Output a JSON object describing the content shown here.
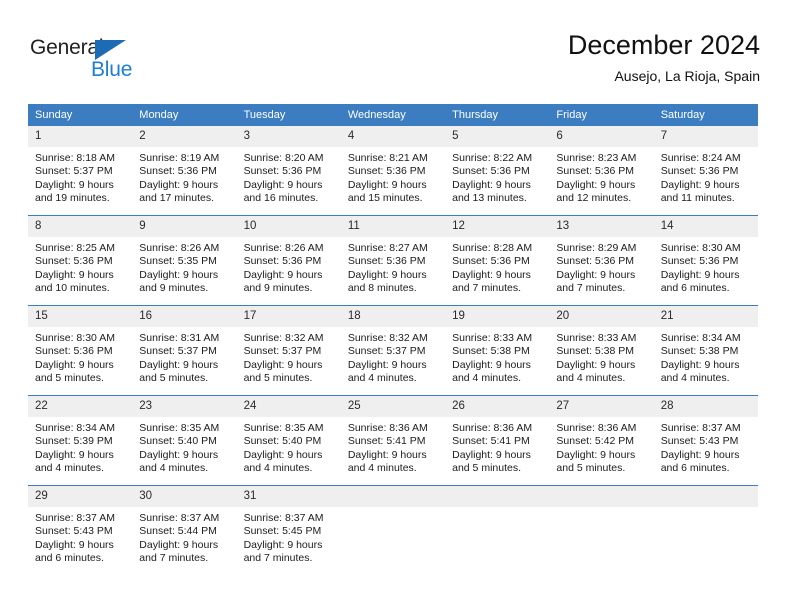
{
  "brand": {
    "name_part1": "General",
    "name_part2": "Blue",
    "triangle_color": "#1b6cb5",
    "blue_color": "#1b7fd4"
  },
  "header": {
    "title": "December 2024",
    "subtitle": "Ausejo, La Rioja, Spain"
  },
  "theme": {
    "header_bg": "#3b7dc0",
    "daynum_bg": "#efefef",
    "separator": "#3b7dc0"
  },
  "weekday_headers": [
    "Sunday",
    "Monday",
    "Tuesday",
    "Wednesday",
    "Thursday",
    "Friday",
    "Saturday"
  ],
  "weeks": [
    {
      "days": [
        {
          "num": "1",
          "sunrise": "Sunrise: 8:18 AM",
          "sunset": "Sunset: 5:37 PM",
          "daylight1": "Daylight: 9 hours",
          "daylight2": "and 19 minutes."
        },
        {
          "num": "2",
          "sunrise": "Sunrise: 8:19 AM",
          "sunset": "Sunset: 5:36 PM",
          "daylight1": "Daylight: 9 hours",
          "daylight2": "and 17 minutes."
        },
        {
          "num": "3",
          "sunrise": "Sunrise: 8:20 AM",
          "sunset": "Sunset: 5:36 PM",
          "daylight1": "Daylight: 9 hours",
          "daylight2": "and 16 minutes."
        },
        {
          "num": "4",
          "sunrise": "Sunrise: 8:21 AM",
          "sunset": "Sunset: 5:36 PM",
          "daylight1": "Daylight: 9 hours",
          "daylight2": "and 15 minutes."
        },
        {
          "num": "5",
          "sunrise": "Sunrise: 8:22 AM",
          "sunset": "Sunset: 5:36 PM",
          "daylight1": "Daylight: 9 hours",
          "daylight2": "and 13 minutes."
        },
        {
          "num": "6",
          "sunrise": "Sunrise: 8:23 AM",
          "sunset": "Sunset: 5:36 PM",
          "daylight1": "Daylight: 9 hours",
          "daylight2": "and 12 minutes."
        },
        {
          "num": "7",
          "sunrise": "Sunrise: 8:24 AM",
          "sunset": "Sunset: 5:36 PM",
          "daylight1": "Daylight: 9 hours",
          "daylight2": "and 11 minutes."
        }
      ]
    },
    {
      "days": [
        {
          "num": "8",
          "sunrise": "Sunrise: 8:25 AM",
          "sunset": "Sunset: 5:36 PM",
          "daylight1": "Daylight: 9 hours",
          "daylight2": "and 10 minutes."
        },
        {
          "num": "9",
          "sunrise": "Sunrise: 8:26 AM",
          "sunset": "Sunset: 5:35 PM",
          "daylight1": "Daylight: 9 hours",
          "daylight2": "and 9 minutes."
        },
        {
          "num": "10",
          "sunrise": "Sunrise: 8:26 AM",
          "sunset": "Sunset: 5:36 PM",
          "daylight1": "Daylight: 9 hours",
          "daylight2": "and 9 minutes."
        },
        {
          "num": "11",
          "sunrise": "Sunrise: 8:27 AM",
          "sunset": "Sunset: 5:36 PM",
          "daylight1": "Daylight: 9 hours",
          "daylight2": "and 8 minutes."
        },
        {
          "num": "12",
          "sunrise": "Sunrise: 8:28 AM",
          "sunset": "Sunset: 5:36 PM",
          "daylight1": "Daylight: 9 hours",
          "daylight2": "and 7 minutes."
        },
        {
          "num": "13",
          "sunrise": "Sunrise: 8:29 AM",
          "sunset": "Sunset: 5:36 PM",
          "daylight1": "Daylight: 9 hours",
          "daylight2": "and 7 minutes."
        },
        {
          "num": "14",
          "sunrise": "Sunrise: 8:30 AM",
          "sunset": "Sunset: 5:36 PM",
          "daylight1": "Daylight: 9 hours",
          "daylight2": "and 6 minutes."
        }
      ]
    },
    {
      "days": [
        {
          "num": "15",
          "sunrise": "Sunrise: 8:30 AM",
          "sunset": "Sunset: 5:36 PM",
          "daylight1": "Daylight: 9 hours",
          "daylight2": "and 5 minutes."
        },
        {
          "num": "16",
          "sunrise": "Sunrise: 8:31 AM",
          "sunset": "Sunset: 5:37 PM",
          "daylight1": "Daylight: 9 hours",
          "daylight2": "and 5 minutes."
        },
        {
          "num": "17",
          "sunrise": "Sunrise: 8:32 AM",
          "sunset": "Sunset: 5:37 PM",
          "daylight1": "Daylight: 9 hours",
          "daylight2": "and 5 minutes."
        },
        {
          "num": "18",
          "sunrise": "Sunrise: 8:32 AM",
          "sunset": "Sunset: 5:37 PM",
          "daylight1": "Daylight: 9 hours",
          "daylight2": "and 4 minutes."
        },
        {
          "num": "19",
          "sunrise": "Sunrise: 8:33 AM",
          "sunset": "Sunset: 5:38 PM",
          "daylight1": "Daylight: 9 hours",
          "daylight2": "and 4 minutes."
        },
        {
          "num": "20",
          "sunrise": "Sunrise: 8:33 AM",
          "sunset": "Sunset: 5:38 PM",
          "daylight1": "Daylight: 9 hours",
          "daylight2": "and 4 minutes."
        },
        {
          "num": "21",
          "sunrise": "Sunrise: 8:34 AM",
          "sunset": "Sunset: 5:38 PM",
          "daylight1": "Daylight: 9 hours",
          "daylight2": "and 4 minutes."
        }
      ]
    },
    {
      "days": [
        {
          "num": "22",
          "sunrise": "Sunrise: 8:34 AM",
          "sunset": "Sunset: 5:39 PM",
          "daylight1": "Daylight: 9 hours",
          "daylight2": "and 4 minutes."
        },
        {
          "num": "23",
          "sunrise": "Sunrise: 8:35 AM",
          "sunset": "Sunset: 5:40 PM",
          "daylight1": "Daylight: 9 hours",
          "daylight2": "and 4 minutes."
        },
        {
          "num": "24",
          "sunrise": "Sunrise: 8:35 AM",
          "sunset": "Sunset: 5:40 PM",
          "daylight1": "Daylight: 9 hours",
          "daylight2": "and 4 minutes."
        },
        {
          "num": "25",
          "sunrise": "Sunrise: 8:36 AM",
          "sunset": "Sunset: 5:41 PM",
          "daylight1": "Daylight: 9 hours",
          "daylight2": "and 4 minutes."
        },
        {
          "num": "26",
          "sunrise": "Sunrise: 8:36 AM",
          "sunset": "Sunset: 5:41 PM",
          "daylight1": "Daylight: 9 hours",
          "daylight2": "and 5 minutes."
        },
        {
          "num": "27",
          "sunrise": "Sunrise: 8:36 AM",
          "sunset": "Sunset: 5:42 PM",
          "daylight1": "Daylight: 9 hours",
          "daylight2": "and 5 minutes."
        },
        {
          "num": "28",
          "sunrise": "Sunrise: 8:37 AM",
          "sunset": "Sunset: 5:43 PM",
          "daylight1": "Daylight: 9 hours",
          "daylight2": "and 6 minutes."
        }
      ]
    },
    {
      "days": [
        {
          "num": "29",
          "sunrise": "Sunrise: 8:37 AM",
          "sunset": "Sunset: 5:43 PM",
          "daylight1": "Daylight: 9 hours",
          "daylight2": "and 6 minutes."
        },
        {
          "num": "30",
          "sunrise": "Sunrise: 8:37 AM",
          "sunset": "Sunset: 5:44 PM",
          "daylight1": "Daylight: 9 hours",
          "daylight2": "and 7 minutes."
        },
        {
          "num": "31",
          "sunrise": "Sunrise: 8:37 AM",
          "sunset": "Sunset: 5:45 PM",
          "daylight1": "Daylight: 9 hours",
          "daylight2": "and 7 minutes."
        },
        {
          "num": "",
          "sunrise": "",
          "sunset": "",
          "daylight1": "",
          "daylight2": ""
        },
        {
          "num": "",
          "sunrise": "",
          "sunset": "",
          "daylight1": "",
          "daylight2": ""
        },
        {
          "num": "",
          "sunrise": "",
          "sunset": "",
          "daylight1": "",
          "daylight2": ""
        },
        {
          "num": "",
          "sunrise": "",
          "sunset": "",
          "daylight1": "",
          "daylight2": ""
        }
      ]
    }
  ]
}
